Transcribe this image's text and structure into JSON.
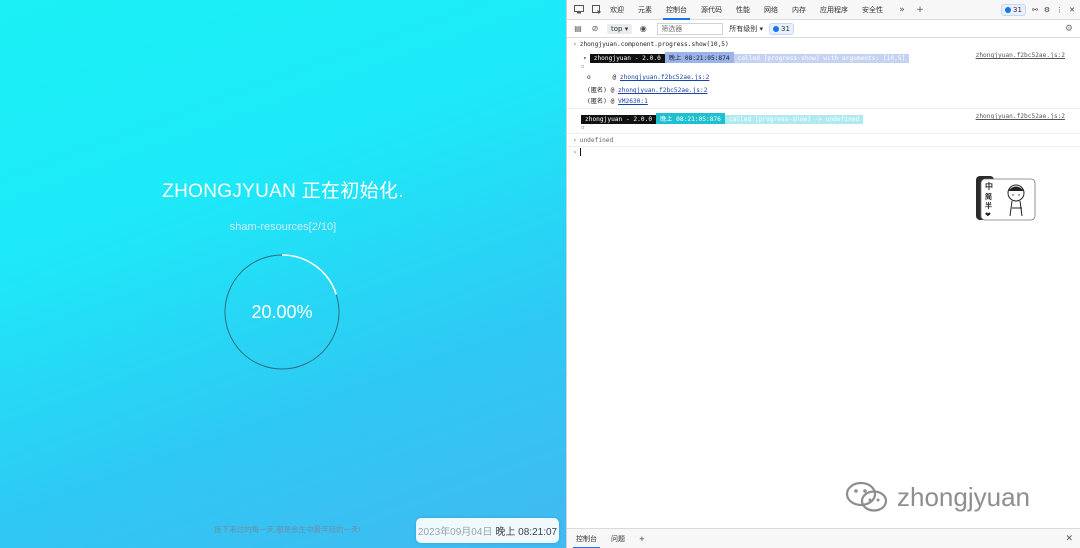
{
  "app": {
    "title": "ZHONGJYUAN 正在初始化.",
    "subtitle": "sham-resources[2/10]",
    "progress_text": "20.00%",
    "progress_fraction": 0.2,
    "quote": "接下来过的每一天,都是余生中最年轻的一天!",
    "clock_date": "2023年09月04日",
    "clock_time": "晚上 08:21:07"
  },
  "devtools": {
    "tabs": [
      "欢迎",
      "元素",
      "控制台",
      "源代码",
      "性能",
      "网络",
      "内存",
      "应用程序",
      "安全性"
    ],
    "active_tab": "控制台",
    "issues_count": "31",
    "toolbar": {
      "context": "top",
      "filter_placeholder": "筛选器",
      "levels": "所有级别 ▾",
      "issues": "31"
    },
    "console": {
      "command": "zhongjyuan.component.progress.show(10,5)",
      "log1": {
        "name": "zhongjyuan - 2.0.0",
        "time": "晚上 08:21:05:874",
        "msg": "called [progress-show] with arguments: [10,5]",
        "source": "zhongjyuan.f2bc52ae.js:2"
      },
      "trace": [
        {
          "fn": "o",
          "link": "zhongjyuan.f2bc52ae.js:2"
        },
        {
          "fn": "(匿名)",
          "link": "zhongjyuan.f2bc52ae.js:2"
        },
        {
          "fn": "(匿名)",
          "link": "VM2630:1"
        }
      ],
      "log2": {
        "name": "zhongjyuan - 2.0.0",
        "time": "晚上 08:21:05:876",
        "msg": "called [progress-show] -> undefined",
        "source": "zhongjyuan.f2bc52ae.js:2"
      },
      "result": "undefined"
    },
    "bottom_tabs": [
      "控制台",
      "问题"
    ]
  },
  "sticker": {
    "chars": [
      "中",
      "简",
      "半"
    ]
  },
  "watermark": {
    "text": "zhongjyuan"
  },
  "colors": {
    "accent": "#1a73e8",
    "bg_start": "#1af0f6",
    "bg_end": "#42b9f2"
  }
}
